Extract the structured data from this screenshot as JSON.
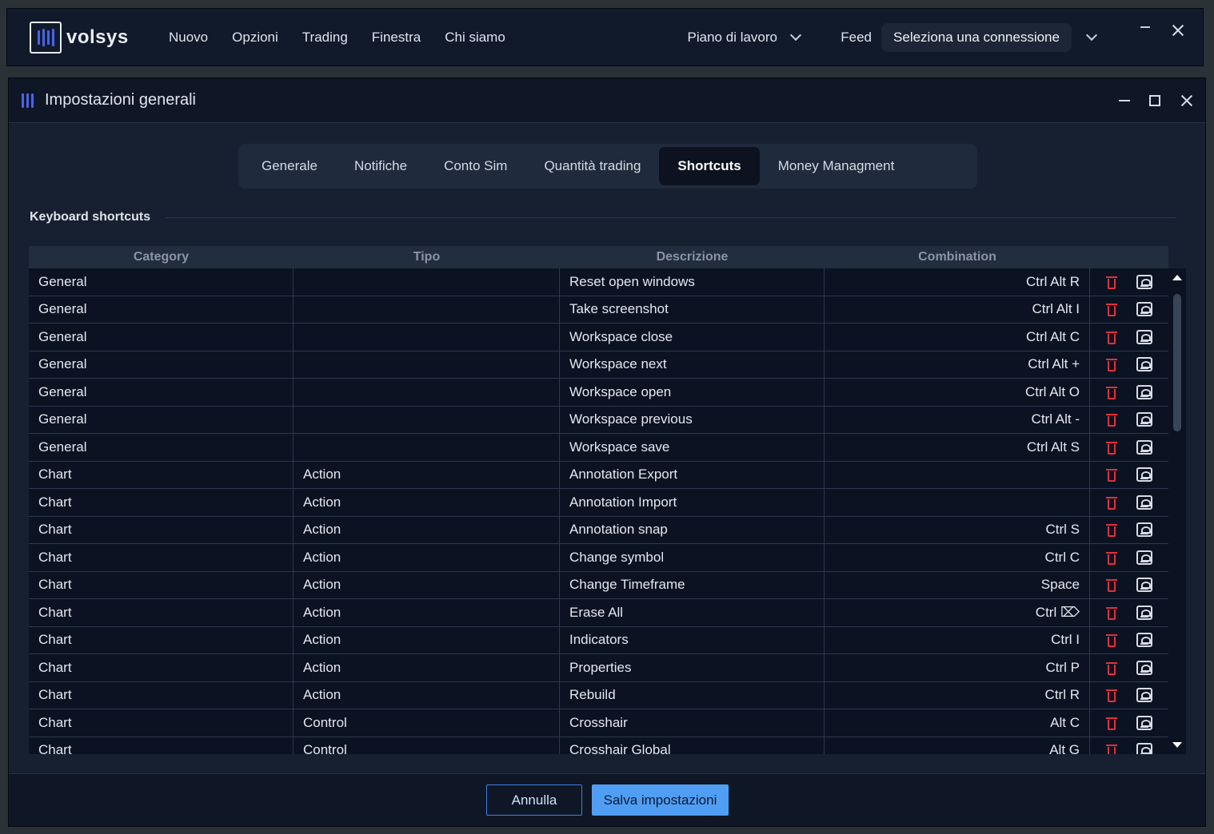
{
  "app": {
    "logo_text": "volsys",
    "menu": [
      "Nuovo",
      "Opzioni",
      "Trading",
      "Finestra",
      "Chi siamo"
    ],
    "workspace_label": "Piano di lavoro",
    "feed_label": "Feed",
    "connection_select": "Seleziona una connessione"
  },
  "dialog": {
    "title": "Impostazioni generali",
    "tabs": [
      "Generale",
      "Notifiche",
      "Conto Sim",
      "Quantità trading",
      "Shortcuts",
      "Money Managment"
    ],
    "active_tab": "Shortcuts",
    "section_label": "Keyboard shortcuts",
    "table": {
      "columns": [
        "Category",
        "Tipo",
        "Descrizione",
        "Combination"
      ],
      "rows": [
        [
          "General",
          "",
          "Reset open windows",
          "Ctrl Alt R"
        ],
        [
          "General",
          "",
          "Take screenshot",
          "Ctrl Alt I"
        ],
        [
          "General",
          "",
          "Workspace close",
          "Ctrl Alt C"
        ],
        [
          "General",
          "",
          "Workspace next",
          "Ctrl Alt +"
        ],
        [
          "General",
          "",
          "Workspace open",
          "Ctrl Alt O"
        ],
        [
          "General",
          "",
          "Workspace previous",
          "Ctrl Alt -"
        ],
        [
          "General",
          "",
          "Workspace save",
          "Ctrl Alt S"
        ],
        [
          "Chart",
          "Action",
          "Annotation Export",
          ""
        ],
        [
          "Chart",
          "Action",
          "Annotation Import",
          ""
        ],
        [
          "Chart",
          "Action",
          "Annotation snap",
          "Ctrl S"
        ],
        [
          "Chart",
          "Action",
          "Change symbol",
          "Ctrl C"
        ],
        [
          "Chart",
          "Action",
          "Change Timeframe",
          "Space"
        ],
        [
          "Chart",
          "Action",
          "Erase All",
          "Ctrl ⌦"
        ],
        [
          "Chart",
          "Action",
          "Indicators",
          "Ctrl I"
        ],
        [
          "Chart",
          "Action",
          "Properties",
          "Ctrl P"
        ],
        [
          "Chart",
          "Action",
          "Rebuild",
          "Ctrl R"
        ],
        [
          "Chart",
          "Control",
          "Crosshair",
          "Alt C"
        ],
        [
          "Chart",
          "Control",
          "Crosshair Global",
          "Alt G"
        ]
      ]
    },
    "buttons": {
      "cancel": "Annulla",
      "save": "Salva impostazioni"
    }
  },
  "colors": {
    "accent": "#4f9ef4",
    "brand": "#4a63e8",
    "delete": "#e0313e"
  }
}
